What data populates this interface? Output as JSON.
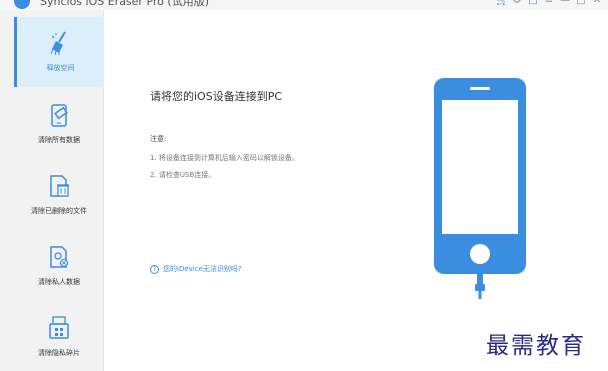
{
  "window": {
    "title": "Syncios iOS Eraser Pro (试用版)",
    "controls": [
      "cart-icon",
      "gear-icon",
      "gift-icon",
      "menu-icon",
      "minimize-icon",
      "maximize-icon",
      "close-icon"
    ]
  },
  "sidebar": {
    "items": [
      {
        "label": "释放空间",
        "icon": "broom-icon",
        "active": true
      },
      {
        "label": "清除所有数据",
        "icon": "phone-eraser-icon",
        "active": false
      },
      {
        "label": "清除已删除的文件",
        "icon": "file-trash-icon",
        "active": false
      },
      {
        "label": "清除私人数据",
        "icon": "private-file-icon",
        "active": false
      },
      {
        "label": "清除隐私碎片",
        "icon": "shredder-icon",
        "active": false
      }
    ]
  },
  "main": {
    "title": "请将您的iOS设备连接到PC",
    "notes_heading": "注意:",
    "notes": [
      "1. 将设备连接到计算机后输入密码以解锁设备。",
      "2. 请检查USB连接。"
    ],
    "help_link": "您的iDevice无法识别吗?"
  },
  "colors": {
    "accent": "#3b8de0",
    "sidebar_bg": "#f2f2f2",
    "active_bg": "#ddeefb"
  },
  "watermark": "最需教育"
}
